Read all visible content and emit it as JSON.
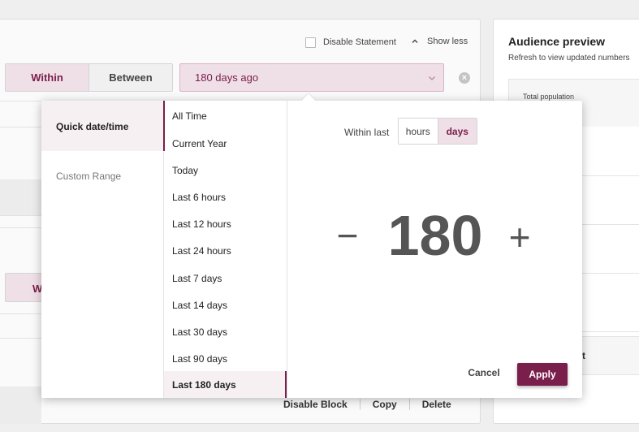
{
  "statement": {
    "disable_statement_label": "Disable Statement",
    "show_less_label": "Show less",
    "range_tabs": [
      {
        "label": "Within"
      },
      {
        "label": "Between"
      }
    ],
    "date_value": "180 days ago",
    "clear_symbol": "×",
    "ghost_within_label": "Within"
  },
  "block_actions": {
    "disable_block": "Disable Block",
    "copy": "Copy",
    "delete": "Delete"
  },
  "audience": {
    "title": "Audience preview",
    "subtitle": "Refresh to view updated numbers",
    "total_population_label": "Total population",
    "bottom_partial_label": "ort"
  },
  "date_picker": {
    "modes": [
      "Quick date/time",
      "Custom Range"
    ],
    "presets": [
      "All Time",
      "Current Year",
      "Today",
      "Last 6 hours",
      "Last 12 hours",
      "Last 24 hours",
      "Last 7 days",
      "Last 14 days",
      "Last 30 days",
      "Last 90 days",
      "Last 180 days"
    ],
    "selected_preset": "Last 180 days",
    "within_last_label": "Within last",
    "units": {
      "hours": "hours",
      "days": "days"
    },
    "selected_unit": "days",
    "stepper": {
      "minus": "−",
      "value": "180",
      "plus": "+"
    },
    "cancel_label": "Cancel",
    "apply_label": "Apply"
  },
  "colors": {
    "accent": "#7a1e4b",
    "accent_light": "#efdfe6"
  },
  "icons": {
    "dropdown": "chevron-down-icon",
    "show_less": "chevron-up-icon",
    "clear": "clear-circle-icon",
    "checkbox": "checkbox-unchecked-icon"
  }
}
